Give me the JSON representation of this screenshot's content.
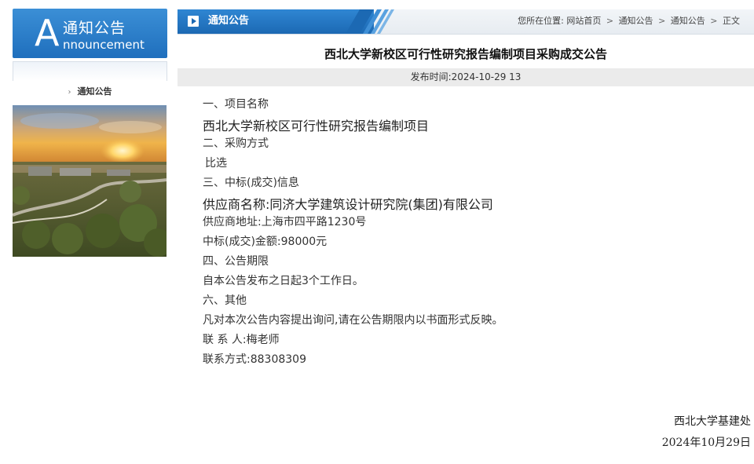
{
  "sidebar": {
    "banner_letter": "A",
    "banner_cn": "通知公告",
    "banner_en": "nnouncement",
    "nav_item": "通知公告"
  },
  "header": {
    "section_title": "通知公告",
    "breadcrumb_prefix": "您所在位置:",
    "crumbs": [
      "网站首页",
      "通知公告",
      "通知公告",
      "正文"
    ],
    "separator": ">"
  },
  "article": {
    "title": "西北大学新校区可行性研究报告编制项目采购成交公告",
    "publish_time": "发布时间:2024-10-29 13",
    "lines": [
      "一、项目名称",
      "西北大学新校区可行性研究报告编制项目",
      "二、采购方式",
      "比选",
      "三、中标(成交)信息",
      "供应商名称:同济大学建筑设计研究院(集团)有限公司",
      "供应商地址:上海市四平路1230号",
      "中标(成交)金额:98000元",
      "四、公告期限",
      "自本公告发布之日起3个工作日。",
      "六、其他",
      "凡对本次公告内容提出询问,请在公告期限内以书面形式反映。",
      "联 系 人:梅老师",
      "联系方式:88308309"
    ],
    "signature_org": "西北大学基建处",
    "signature_date": "2024年10月29日"
  },
  "colors": {
    "brand_blue": "#1f6fbd",
    "header_bg": "#eef2f6",
    "pubbar_bg": "#ebebeb"
  }
}
